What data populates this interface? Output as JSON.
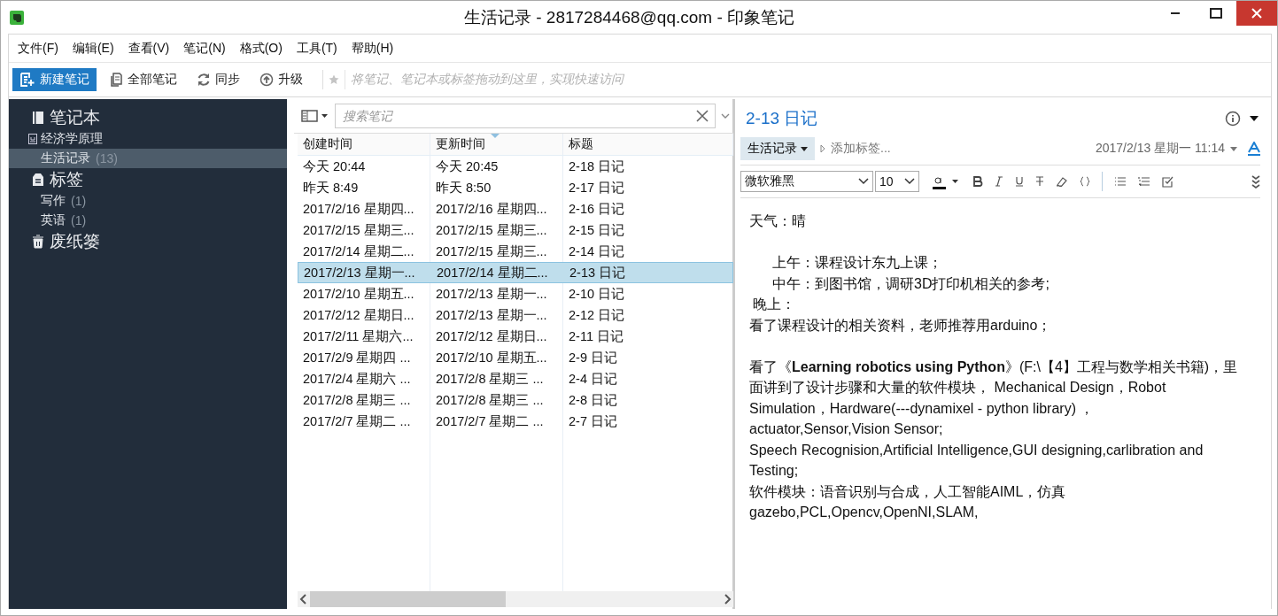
{
  "window": {
    "title": "生活记录 - 2817284468@qq.com - 印象笔记"
  },
  "menu": [
    "文件(F)",
    "编辑(E)",
    "查看(V)",
    "笔记(N)",
    "格式(O)",
    "工具(T)",
    "帮助(H)"
  ],
  "toolbar": {
    "buttons": [
      {
        "kind": "new-note",
        "label": "新建笔记"
      },
      {
        "kind": "all-notes",
        "label": "全部笔记"
      },
      {
        "kind": "sync",
        "label": "同步"
      },
      {
        "kind": "upgrade",
        "label": "升级"
      }
    ],
    "shortcuts_placeholder": "将笔记、笔记本或标签拖动到这里，实现快速访问"
  },
  "sidebar": {
    "sections": [
      {
        "kind": "notebooks",
        "label": "笔记本",
        "items": [
          {
            "kind": "stack",
            "label": "经济学原理",
            "selected": false
          },
          {
            "kind": "notebook",
            "label": "生活记录",
            "count": "(13)",
            "selected": true
          }
        ]
      },
      {
        "kind": "tags",
        "label": "标签",
        "items": [
          {
            "kind": "tag",
            "label": "写作",
            "count": "(1)",
            "selected": false
          },
          {
            "kind": "tag",
            "label": "英语",
            "count": "(1)",
            "selected": false
          }
        ]
      },
      {
        "kind": "trash",
        "label": "废纸篓"
      }
    ]
  },
  "note_list": {
    "search": {
      "placeholder": "搜索笔记"
    },
    "columns": [
      {
        "label": "创建时间",
        "sorted": false
      },
      {
        "label": "更新时间",
        "sorted": true
      },
      {
        "label": "标题",
        "sorted": false
      }
    ],
    "rows": [
      {
        "cells": [
          "今天 20:44",
          "今天 20:45",
          "2-18 日记"
        ],
        "selected": false
      },
      {
        "cells": [
          "昨天 8:49",
          "昨天 8:50",
          "2-17 日记"
        ],
        "selected": false
      },
      {
        "cells": [
          "2017/2/16 星期四...",
          "2017/2/16 星期四...",
          "2-16 日记"
        ],
        "selected": false
      },
      {
        "cells": [
          "2017/2/15 星期三...",
          "2017/2/15 星期三...",
          "2-15 日记"
        ],
        "selected": false
      },
      {
        "cells": [
          "2017/2/14 星期二...",
          "2017/2/15 星期三...",
          "2-14 日记"
        ],
        "selected": false
      },
      {
        "cells": [
          "2017/2/13 星期一...",
          "2017/2/14 星期二...",
          "2-13 日记"
        ],
        "selected": true
      },
      {
        "cells": [
          "2017/2/10 星期五...",
          "2017/2/13 星期一...",
          "2-10 日记"
        ],
        "selected": false
      },
      {
        "cells": [
          "2017/2/12 星期日...",
          "2017/2/13 星期一...",
          "2-12 日记"
        ],
        "selected": false
      },
      {
        "cells": [
          "2017/2/11 星期六...",
          "2017/2/12 星期日...",
          "2-11 日记"
        ],
        "selected": false
      },
      {
        "cells": [
          "2017/2/9 星期四 ...",
          "2017/2/10 星期五...",
          "2-9 日记"
        ],
        "selected": false
      },
      {
        "cells": [
          "2017/2/4 星期六 ...",
          "2017/2/8 星期三 ...",
          "2-4 日记"
        ],
        "selected": false
      },
      {
        "cells": [
          "2017/2/8 星期三 ...",
          "2017/2/8 星期三 ...",
          "2-8 日记"
        ],
        "selected": false
      },
      {
        "cells": [
          "2017/2/7 星期二 ...",
          "2017/2/7 星期二 ...",
          "2-7 日记"
        ],
        "selected": false
      }
    ]
  },
  "note": {
    "title": "2-13 日记",
    "notebook": "生活记录",
    "tag_placeholder": "添加标签...",
    "date": "2017/2/13 星期一 11:14",
    "font": "微软雅黑",
    "font_size": "10",
    "body": [
      {
        "kind": "plain",
        "text": "天气：晴"
      },
      {
        "kind": "blank"
      },
      {
        "kind": "indent",
        "text": "上午：课程设计东九上课；"
      },
      {
        "kind": "indent",
        "text": "中午：到图书馆，调研3D打印机相关的参考;"
      },
      {
        "kind": "small-indent",
        "text": "晚上："
      },
      {
        "kind": "plain",
        "text": "看了课程设计的相关资料，老师推荐用arduino；"
      },
      {
        "kind": "blank"
      },
      {
        "kind": "plain",
        "text": "看了《**Learning robotics using Python**》(F:\\【4】工程与数学相关书籍)，里面讲到了设计步骤和大量的软件模块，           Mechanical Design，Robot Simulation，Hardware(---dynamixel - python library)  ，"
      },
      {
        "kind": "plain",
        "text": "actuator,Sensor,Vision Sensor;"
      },
      {
        "kind": "plain",
        "text": "Speech Recognision,Artificial Intelligence,GUI designing,carlibration and Testing;"
      },
      {
        "kind": "plain",
        "text": "软件模块：语音识别与合成，人工智能AIML，仿真"
      },
      {
        "kind": "plain",
        "text": "gazebo,PCL,Opencv,OpenNI,SLAM,"
      }
    ]
  }
}
